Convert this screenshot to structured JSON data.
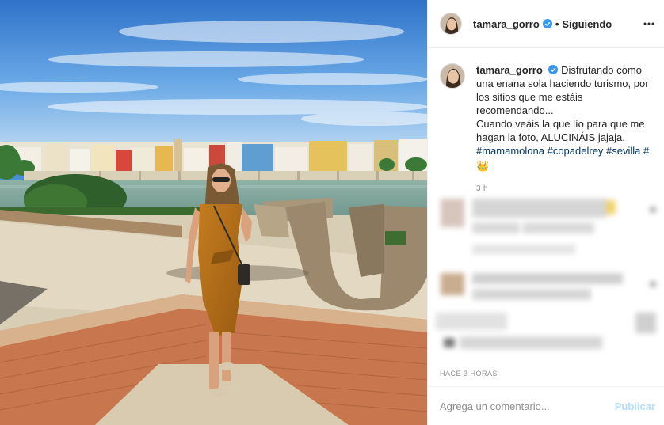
{
  "post": {
    "username": "tamara_gorro",
    "follow_status": "Siguiendo",
    "separator": "•",
    "caption_text": "Disfrutando como una enana sola haciendo turismo, por los sitios que me estáis recomendando...",
    "caption_text2": "Cuando veáis la que lío para que me hagan la foto, ALUCINÁIS jajaja.",
    "hashtags": "#mamamolona #copadelrey #sevilla #",
    "crown_emoji": "👑",
    "caption_age": "3 h",
    "posted_ago": "HACE 3 HORAS"
  },
  "composer": {
    "placeholder": "Agrega un comentario...",
    "publish_label": "Publicar"
  },
  "icons": {
    "verified": "verified-badge-icon",
    "more": "more-options-icon"
  },
  "colors": {
    "verified": "#3897f0",
    "hashtag": "#00376b",
    "publish_disabled": "#b2dffc",
    "meta": "#8e8e8e"
  }
}
